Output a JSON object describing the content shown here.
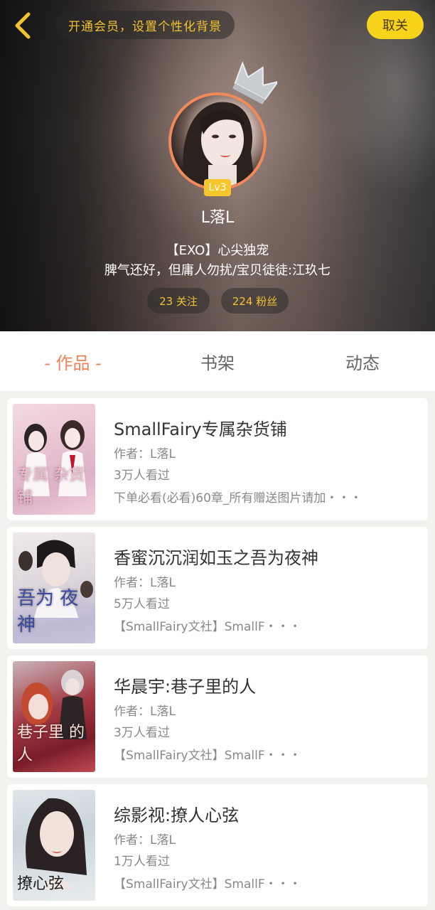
{
  "header": {
    "promo_text": "开通会员，设置个性化背景",
    "close_label": "取关",
    "level": "Lv3",
    "username": "L落L",
    "bio_line1": "【EXO】心尖独宠",
    "bio_line2": "脾气还好，但庸人勿扰/宝贝徒徒:江玖七",
    "following": "23 关注",
    "followers": "224 粉丝"
  },
  "tabs": {
    "works": "- 作品 -",
    "shelf": "书架",
    "feed": "动态"
  },
  "books": [
    {
      "title": "SmallFairy专属杂货铺",
      "author": "作者：L落L",
      "views": "3万人看过",
      "desc": "下单必看(必看)60章_所有赠送图片请加・・・",
      "cover_text": "专属 杂货铺"
    },
    {
      "title": "香蜜沉沉润如玉之吾为夜神",
      "author": "作者：L落L",
      "views": "5万人看过",
      "desc": "【SmallFairy文社】SmallF・・・",
      "cover_text": "吾为 夜神"
    },
    {
      "title": "华晨宇:巷子里的人",
      "author": "作者：L落L",
      "views": "3万人看过",
      "desc": "【SmallFairy文社】SmallF・・・",
      "cover_text": "巷子里 的人"
    },
    {
      "title": "综影视:撩人心弦",
      "author": "作者：L落L",
      "views": "1万人看过",
      "desc": "【SmallFairy文社】SmallF・・・",
      "cover_text": "撩心弦"
    }
  ],
  "colors": {
    "accent": "#ef8354",
    "vip_yellow": "#f7d31c",
    "badge_gold": "#f6c62c"
  },
  "icons": {
    "back": "chevron-left-icon",
    "crown": "crown-icon"
  }
}
